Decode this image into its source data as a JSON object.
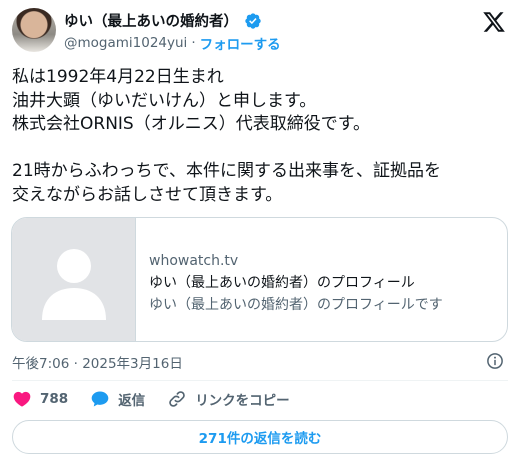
{
  "author": {
    "name": "ゆい（最上あいの婚約者）",
    "handle": "@mogami1024yui",
    "separator": "·",
    "follow_label": "フォローする"
  },
  "tweet": {
    "text": "私は1992年4月22日生まれ\n油井大顕（ゆいだいけん）と申します。\n株式会社ORNIS（オルニス）代表取締役です。\n\n21時からふわっちで、本件に関する出来事を、証拠品を\n交えながらお話しさせて頂きます。"
  },
  "card": {
    "domain": "whowatch.tv",
    "title": "ゆい（最上あいの婚約者）のプロフィール",
    "description": "ゆい（最上あいの婚約者）のプロフィールです"
  },
  "meta": {
    "timestamp": "午後7:06 · 2025年3月16日"
  },
  "actions": {
    "like_count": "788",
    "reply_label": "返信",
    "copy_link_label": "リンクをコピー"
  },
  "footer": {
    "read_replies_label": "271件の返信を読む"
  },
  "colors": {
    "accent": "#1d9bf0",
    "like": "#f91880",
    "secondary_text": "#536471"
  },
  "icons": [
    "verified-badge-icon",
    "x-logo-icon",
    "info-icon",
    "heart-icon",
    "reply-bubble-icon",
    "link-icon",
    "default-avatar-icon"
  ]
}
